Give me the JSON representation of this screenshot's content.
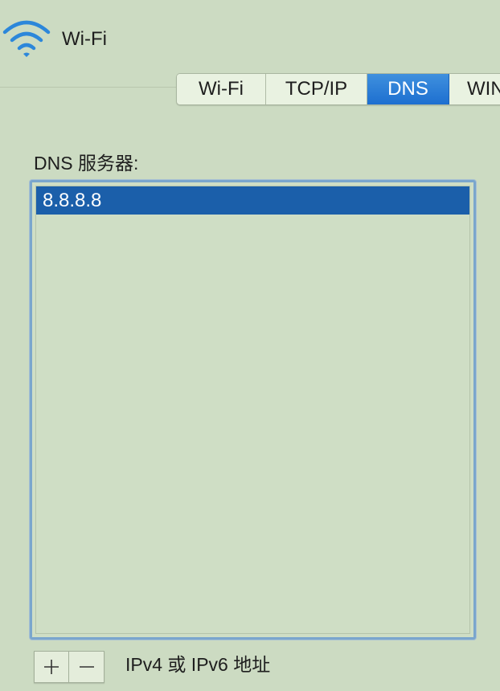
{
  "header": {
    "icon": "wifi-icon",
    "title": "Wi-Fi"
  },
  "tabs": [
    {
      "label": "Wi-Fi",
      "selected": false
    },
    {
      "label": "TCP/IP",
      "selected": false
    },
    {
      "label": "DNS",
      "selected": true
    },
    {
      "label": "WIN",
      "selected": false
    }
  ],
  "dns": {
    "label": "DNS 服务器:",
    "servers": [
      "8.8.8.8"
    ],
    "selected_index": 0
  },
  "footer": {
    "add_icon": "plus-icon",
    "remove_icon": "minus-icon",
    "hint": "IPv4 或 IPv6 地址"
  },
  "colors": {
    "background": "#ccdbc2",
    "selected_tab": "#1d6fd0",
    "selected_row": "#1b5faa",
    "focus_ring": "#7aa6cd"
  }
}
